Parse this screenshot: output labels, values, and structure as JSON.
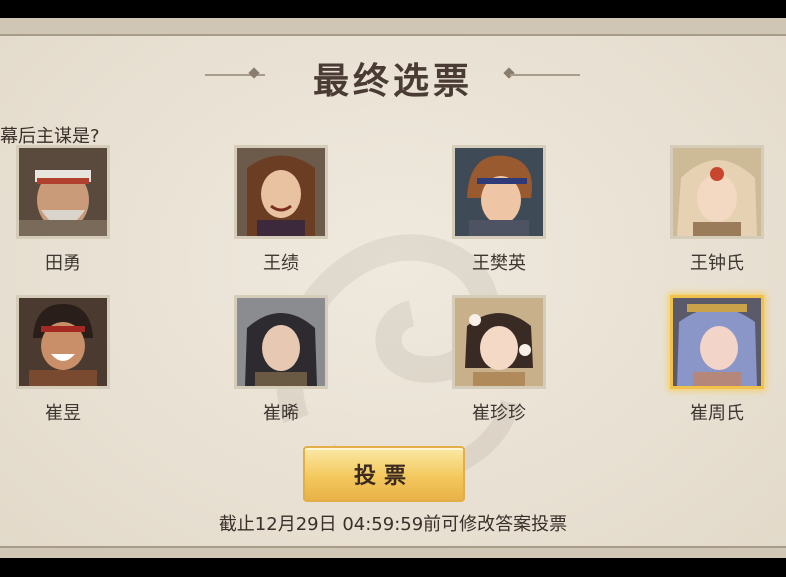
{
  "poll": {
    "title": "最终选票",
    "question": "幕后主谋是?",
    "vote_button": "投票",
    "deadline_text": "截止12月29日 04:59:59前可修改答案投票"
  },
  "candidates": [
    {
      "name": "田勇",
      "selected": false
    },
    {
      "name": "王绩",
      "selected": false
    },
    {
      "name": "王樊英",
      "selected": false
    },
    {
      "name": "王钟氏",
      "selected": false
    },
    {
      "name": "崔昱",
      "selected": false
    },
    {
      "name": "崔晞",
      "selected": false
    },
    {
      "name": "崔珍珍",
      "selected": false
    },
    {
      "name": "崔周氏",
      "selected": true
    }
  ],
  "colors": {
    "panel": "#eae3d6",
    "title_text": "#4a3c34",
    "selected_border": "#f0c24c",
    "button_gold": "#f3c85d"
  }
}
